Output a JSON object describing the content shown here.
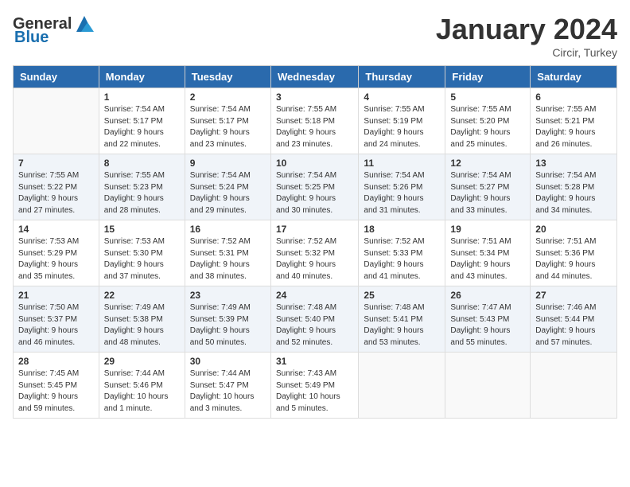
{
  "logo": {
    "general": "General",
    "blue": "Blue"
  },
  "header": {
    "month": "January 2024",
    "location": "Circir, Turkey"
  },
  "days_of_week": [
    "Sunday",
    "Monday",
    "Tuesday",
    "Wednesday",
    "Thursday",
    "Friday",
    "Saturday"
  ],
  "weeks": [
    [
      {
        "day": "",
        "info": ""
      },
      {
        "day": "1",
        "info": "Sunrise: 7:54 AM\nSunset: 5:17 PM\nDaylight: 9 hours\nand 22 minutes."
      },
      {
        "day": "2",
        "info": "Sunrise: 7:54 AM\nSunset: 5:17 PM\nDaylight: 9 hours\nand 23 minutes."
      },
      {
        "day": "3",
        "info": "Sunrise: 7:55 AM\nSunset: 5:18 PM\nDaylight: 9 hours\nand 23 minutes."
      },
      {
        "day": "4",
        "info": "Sunrise: 7:55 AM\nSunset: 5:19 PM\nDaylight: 9 hours\nand 24 minutes."
      },
      {
        "day": "5",
        "info": "Sunrise: 7:55 AM\nSunset: 5:20 PM\nDaylight: 9 hours\nand 25 minutes."
      },
      {
        "day": "6",
        "info": "Sunrise: 7:55 AM\nSunset: 5:21 PM\nDaylight: 9 hours\nand 26 minutes."
      }
    ],
    [
      {
        "day": "7",
        "info": "Sunrise: 7:55 AM\nSunset: 5:22 PM\nDaylight: 9 hours\nand 27 minutes."
      },
      {
        "day": "8",
        "info": "Sunrise: 7:55 AM\nSunset: 5:23 PM\nDaylight: 9 hours\nand 28 minutes."
      },
      {
        "day": "9",
        "info": "Sunrise: 7:54 AM\nSunset: 5:24 PM\nDaylight: 9 hours\nand 29 minutes."
      },
      {
        "day": "10",
        "info": "Sunrise: 7:54 AM\nSunset: 5:25 PM\nDaylight: 9 hours\nand 30 minutes."
      },
      {
        "day": "11",
        "info": "Sunrise: 7:54 AM\nSunset: 5:26 PM\nDaylight: 9 hours\nand 31 minutes."
      },
      {
        "day": "12",
        "info": "Sunrise: 7:54 AM\nSunset: 5:27 PM\nDaylight: 9 hours\nand 33 minutes."
      },
      {
        "day": "13",
        "info": "Sunrise: 7:54 AM\nSunset: 5:28 PM\nDaylight: 9 hours\nand 34 minutes."
      }
    ],
    [
      {
        "day": "14",
        "info": "Sunrise: 7:53 AM\nSunset: 5:29 PM\nDaylight: 9 hours\nand 35 minutes."
      },
      {
        "day": "15",
        "info": "Sunrise: 7:53 AM\nSunset: 5:30 PM\nDaylight: 9 hours\nand 37 minutes."
      },
      {
        "day": "16",
        "info": "Sunrise: 7:52 AM\nSunset: 5:31 PM\nDaylight: 9 hours\nand 38 minutes."
      },
      {
        "day": "17",
        "info": "Sunrise: 7:52 AM\nSunset: 5:32 PM\nDaylight: 9 hours\nand 40 minutes."
      },
      {
        "day": "18",
        "info": "Sunrise: 7:52 AM\nSunset: 5:33 PM\nDaylight: 9 hours\nand 41 minutes."
      },
      {
        "day": "19",
        "info": "Sunrise: 7:51 AM\nSunset: 5:34 PM\nDaylight: 9 hours\nand 43 minutes."
      },
      {
        "day": "20",
        "info": "Sunrise: 7:51 AM\nSunset: 5:36 PM\nDaylight: 9 hours\nand 44 minutes."
      }
    ],
    [
      {
        "day": "21",
        "info": "Sunrise: 7:50 AM\nSunset: 5:37 PM\nDaylight: 9 hours\nand 46 minutes."
      },
      {
        "day": "22",
        "info": "Sunrise: 7:49 AM\nSunset: 5:38 PM\nDaylight: 9 hours\nand 48 minutes."
      },
      {
        "day": "23",
        "info": "Sunrise: 7:49 AM\nSunset: 5:39 PM\nDaylight: 9 hours\nand 50 minutes."
      },
      {
        "day": "24",
        "info": "Sunrise: 7:48 AM\nSunset: 5:40 PM\nDaylight: 9 hours\nand 52 minutes."
      },
      {
        "day": "25",
        "info": "Sunrise: 7:48 AM\nSunset: 5:41 PM\nDaylight: 9 hours\nand 53 minutes."
      },
      {
        "day": "26",
        "info": "Sunrise: 7:47 AM\nSunset: 5:43 PM\nDaylight: 9 hours\nand 55 minutes."
      },
      {
        "day": "27",
        "info": "Sunrise: 7:46 AM\nSunset: 5:44 PM\nDaylight: 9 hours\nand 57 minutes."
      }
    ],
    [
      {
        "day": "28",
        "info": "Sunrise: 7:45 AM\nSunset: 5:45 PM\nDaylight: 9 hours\nand 59 minutes."
      },
      {
        "day": "29",
        "info": "Sunrise: 7:44 AM\nSunset: 5:46 PM\nDaylight: 10 hours\nand 1 minute."
      },
      {
        "day": "30",
        "info": "Sunrise: 7:44 AM\nSunset: 5:47 PM\nDaylight: 10 hours\nand 3 minutes."
      },
      {
        "day": "31",
        "info": "Sunrise: 7:43 AM\nSunset: 5:49 PM\nDaylight: 10 hours\nand 5 minutes."
      },
      {
        "day": "",
        "info": ""
      },
      {
        "day": "",
        "info": ""
      },
      {
        "day": "",
        "info": ""
      }
    ]
  ]
}
